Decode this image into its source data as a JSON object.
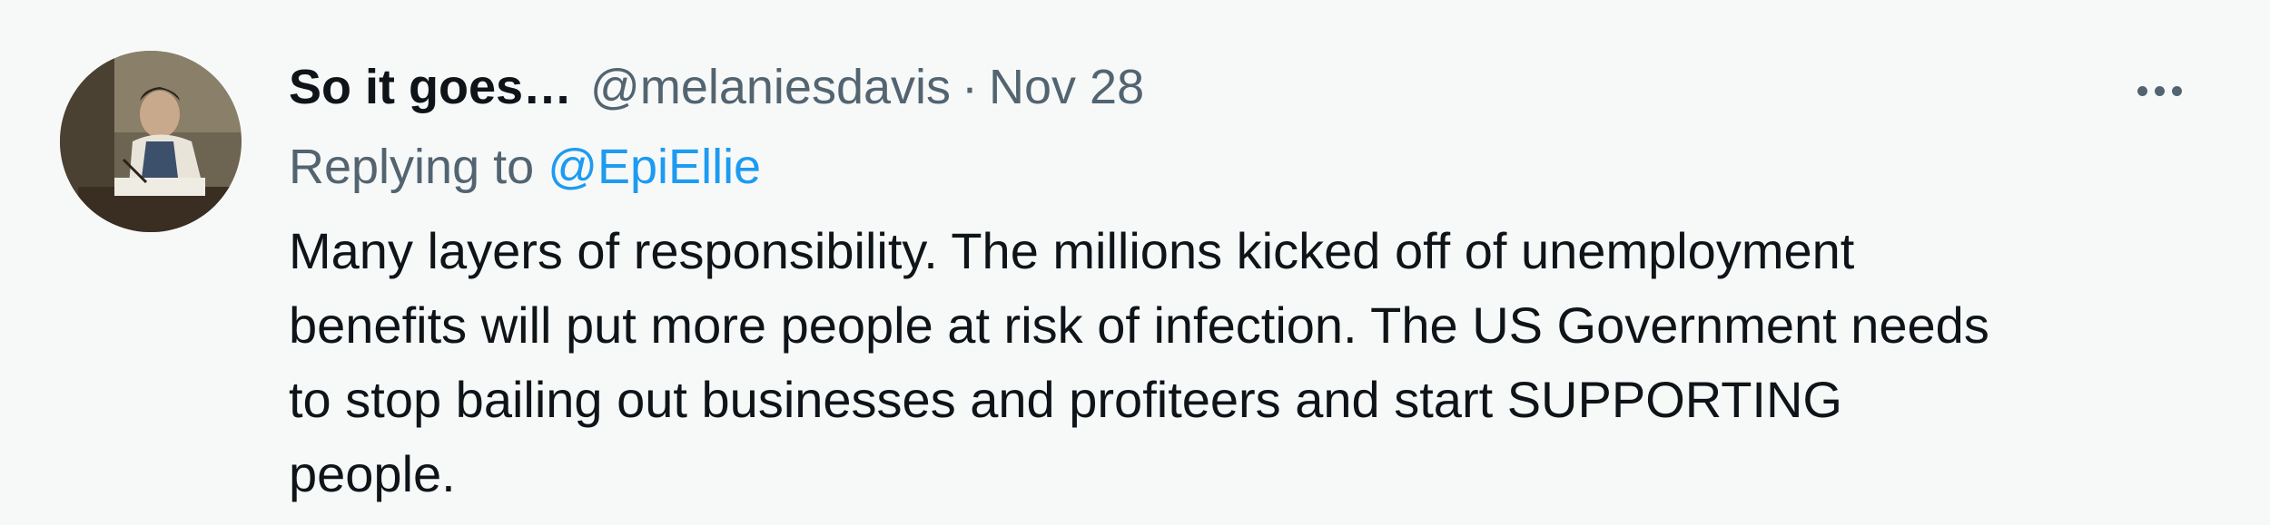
{
  "tweet": {
    "display_name": "So it goes…",
    "handle": "@melaniesdavis",
    "separator": "·",
    "date": "Nov 28",
    "reply_prefix": "Replying to",
    "reply_to": "@EpiEllie",
    "text_lines": [
      "Many layers of responsibility. The millions kicked off of unemployment",
      "benefits will put more people at risk of infection. The US Government needs",
      "to stop bailing out businesses and profiteers and start SUPPORTING",
      "people."
    ],
    "avatar_icon": "profile-photo",
    "more_icon": "more-options-icon"
  },
  "colors": {
    "background": "#f7f9f9",
    "primary_text": "#0f1419",
    "secondary_text": "#536471",
    "link": "#1d9bf0"
  }
}
